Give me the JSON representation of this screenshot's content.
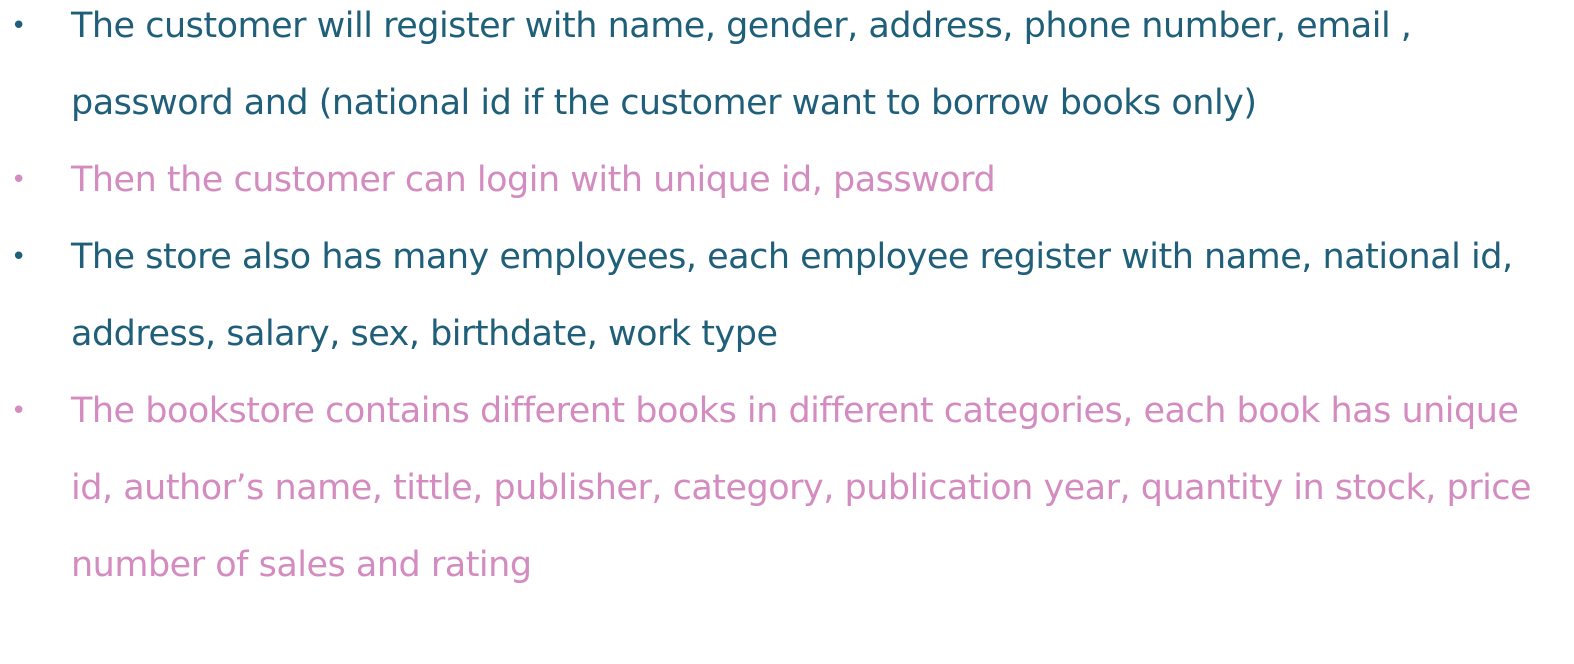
{
  "theme": {
    "teal": "#1f5f7a",
    "pink": "#d48cc0"
  },
  "bullets": [
    {
      "text": "The customer will register with name, gender, address, phone number, email , password and (national id if the customer want to borrow books only)",
      "color": "teal"
    },
    {
      "text": "Then the customer can login with unique id, password",
      "color": "pink"
    },
    {
      "text": "The store also has many employees, each employee register with name, national id, address, salary, sex, birthdate, work type",
      "color": "teal"
    },
    {
      "text": "The bookstore contains different books in different categories, each book has unique id, author’s name, tittle, publisher, category, publication year, quantity in stock, price number of sales and rating",
      "color": "pink"
    }
  ],
  "bullet_glyph": "•"
}
